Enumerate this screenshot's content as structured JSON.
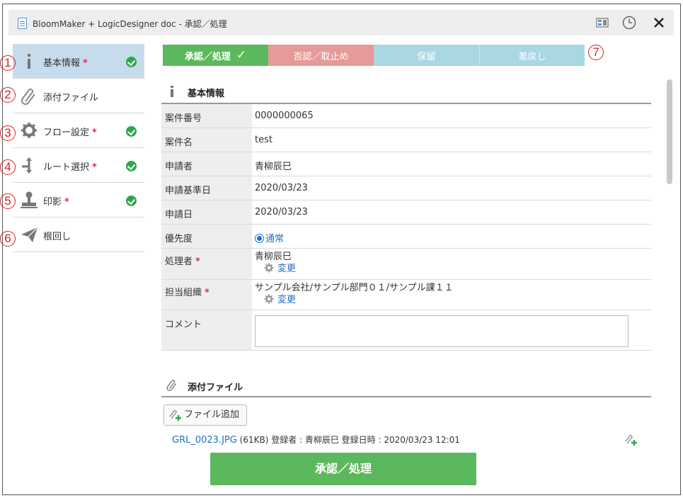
{
  "window": {
    "title": "BloomMaker + LogicDesigner doc - 承認／処理"
  },
  "sidebar": {
    "items": [
      {
        "label": "基本情報",
        "required": "*",
        "num": "1"
      },
      {
        "label": "添付ファイル",
        "num": "2"
      },
      {
        "label": "フロー設定",
        "required": "*",
        "num": "3"
      },
      {
        "label": "ルート選択",
        "required": "*",
        "num": "4"
      },
      {
        "label": "印影",
        "required": "*",
        "num": "5"
      },
      {
        "label": "根回し",
        "num": "6"
      }
    ]
  },
  "status_tabs": {
    "items": [
      "承認／処理",
      "否認／取止め",
      "保留",
      "差戻し"
    ],
    "num": "7"
  },
  "basic": {
    "title": "基本情報",
    "rows": [
      {
        "key": "案件番号",
        "value": "0000000065"
      },
      {
        "key": "案件名",
        "value": "test"
      },
      {
        "key": "申請者",
        "value": "青柳辰巳"
      },
      {
        "key": "申請基準日",
        "value": "2020/03/23"
      },
      {
        "key": "申請日",
        "value": "2020/03/23"
      },
      {
        "key": "優先度",
        "value": "通常"
      },
      {
        "key": "処理者",
        "required": "*",
        "value": "青柳辰巳",
        "action": "変更"
      },
      {
        "key": "担当組織",
        "required": "*",
        "value": "サンプル会社/サンプル部門０１/サンプル課１１",
        "action": "変更"
      },
      {
        "key": "コメント",
        "value": ""
      }
    ]
  },
  "attachments": {
    "title": "添付ファイル",
    "add_label": "ファイル追加",
    "file_name": "GRL_0023.JPG",
    "file_info": "(61KB) 登録者 : 青柳辰巳 登録日時 : 2020/03/23 12:01"
  },
  "footer": {
    "approve_label": "承認／処理"
  },
  "colors": {
    "accent": "#5cb85c",
    "reject": "#e79a9a",
    "hold": "#a9d7e2",
    "active_side": "#c6dcec",
    "link": "#1f6fc6"
  }
}
